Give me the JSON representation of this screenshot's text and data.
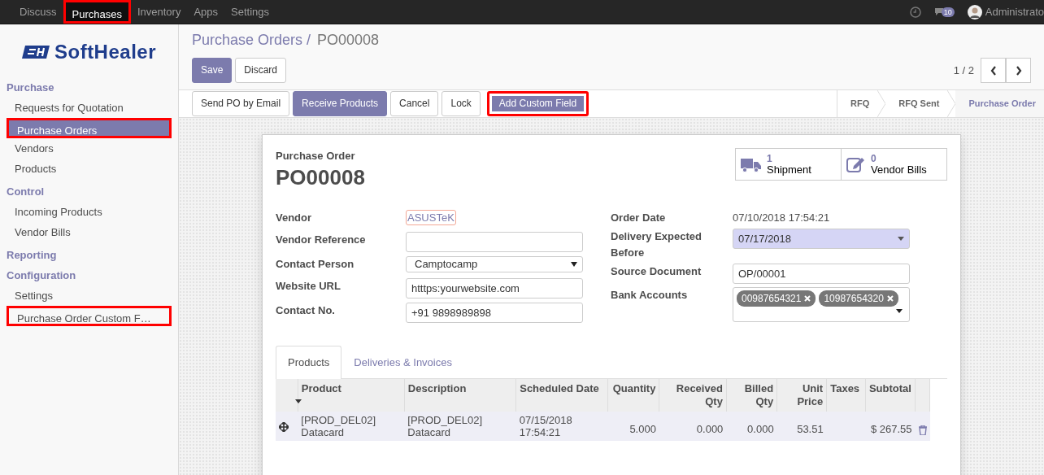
{
  "top_menu": [
    {
      "label": "Discuss",
      "selected": false,
      "highlighted": false
    },
    {
      "label": "Purchases",
      "selected": true,
      "highlighted": true
    },
    {
      "label": "Inventory",
      "selected": false,
      "highlighted": false
    },
    {
      "label": "Apps",
      "selected": false,
      "highlighted": false
    },
    {
      "label": "Settings",
      "selected": false,
      "highlighted": false
    }
  ],
  "systray": {
    "message_count": "10",
    "user": "Administrato"
  },
  "logo": "SoftHealer",
  "sidebar": [
    {
      "title": "Purchase",
      "items": [
        {
          "label": "Requests for Quotation",
          "selected": false,
          "highlighted": false
        },
        {
          "label": "Purchase Orders",
          "selected": true,
          "highlighted": true
        },
        {
          "label": "Vendors",
          "selected": false,
          "highlighted": false
        },
        {
          "label": "Products",
          "selected": false,
          "highlighted": false
        }
      ]
    },
    {
      "title": "Control",
      "items": [
        {
          "label": "Incoming Products",
          "selected": false,
          "highlighted": false
        },
        {
          "label": "Vendor Bills",
          "selected": false,
          "highlighted": false
        }
      ]
    },
    {
      "title": "Reporting"
    },
    {
      "title": "Configuration",
      "items": [
        {
          "label": "Settings",
          "selected": false,
          "highlighted": false
        },
        {
          "label": "Purchase Order Custom F…",
          "selected": false,
          "highlighted": true
        }
      ]
    }
  ],
  "breadcrumb": [
    "Purchase Orders /",
    "PO00008"
  ],
  "edit_buttons": [
    {
      "label": "Save",
      "kind": "primary"
    },
    {
      "label": "Discard",
      "kind": "secondary"
    }
  ],
  "pager": "1 / 2",
  "action_buttons": [
    {
      "label": "Send PO by Email",
      "kind": "secondary",
      "highlighted": false
    },
    {
      "label": "Receive Products",
      "kind": "primary",
      "highlighted": false
    },
    {
      "label": "Cancel",
      "kind": "secondary",
      "highlighted": false
    },
    {
      "label": "Lock",
      "kind": "secondary",
      "highlighted": false
    },
    {
      "label": "Add Custom Field",
      "kind": "primary",
      "highlighted": true
    }
  ],
  "stages": [
    {
      "label": "RFQ",
      "selected": false
    },
    {
      "label": "RFQ Sent",
      "selected": false
    },
    {
      "label": "Purchase Order",
      "selected": true
    }
  ],
  "sheet": {
    "subtitle": "Purchase Order",
    "name": "PO00008",
    "smart_buttons": [
      {
        "count": "1",
        "label": "Shipment",
        "kind": "truck"
      },
      {
        "count": "0",
        "label": "Vendor Bills",
        "kind": "edit"
      }
    ],
    "left_fields": [
      {
        "label": "Vendor",
        "kind": "link",
        "value": "ASUSTeK"
      },
      {
        "label": "Vendor Reference",
        "kind": "input"
      },
      {
        "label": "Contact Person",
        "kind": "select",
        "value": "Camptocamp"
      },
      {
        "label": "Website URL",
        "kind": "input",
        "value": "htttps:yourwebsite.com"
      },
      {
        "label": "Contact No.",
        "kind": "input",
        "value": "+91 9898989898"
      }
    ],
    "right_fields": [
      {
        "label": "Order Date",
        "kind": "text",
        "value": "07/10/2018 17:54:21"
      },
      {
        "label": "Delivery Expected Before",
        "kind": "date",
        "value": "07/17/2018"
      },
      {
        "label": "Source Document",
        "kind": "input",
        "value": "OP/00001"
      },
      {
        "label": "Bank Accounts",
        "kind": "tags",
        "tags": [
          "00987654321",
          "10987654320"
        ]
      }
    ],
    "tabs": [
      {
        "label": "Products",
        "selected": true
      },
      {
        "label": "Deliveries & Invoices",
        "selected": false
      }
    ],
    "table": {
      "columns": [
        "Product",
        "Description",
        "Scheduled Date",
        "Quantity",
        "Received Qty",
        "Billed Qty",
        "Unit Price",
        "Taxes",
        "Subtotal"
      ],
      "rows": [
        {
          "product": "[PROD_DEL02] Datacard",
          "description": "[PROD_DEL02] Datacard",
          "scheduled_date": "07/15/2018 17:54:21",
          "quantity": "5.000",
          "received_qty": "0.000",
          "billed_qty": "0.000",
          "unit_price": "53.51",
          "subtotal": "$ 267.55"
        }
      ]
    }
  }
}
